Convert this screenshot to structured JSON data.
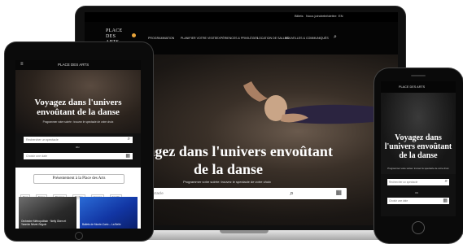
{
  "laptop": {
    "top_links": [
      "Billets",
      "Nous joindre",
      "Infolettre",
      "EN"
    ],
    "logo_lines": [
      "PLACE",
      "DES",
      "ARTS"
    ],
    "nav": [
      "PROGRAMMATION",
      "PLANIFIER VOTRE VISITE",
      "EXPÉRIENCES & PRIVILÈGES",
      "LOCATION DE SALLES",
      "NOUVELLES & COMMUNIQUÉS"
    ],
    "hero_title": "Voyagez dans l'univers envoûtant de la danse",
    "hero_subtitle": "Programmer votre soirée: trouvez le spectacle de votre choix",
    "search_placeholder": "Rechercher un spectacle",
    "search_icon": "magnifier",
    "calendar_icon": "calendar"
  },
  "tablet": {
    "logo": "PLACE DES ARTS",
    "hero_title": "Voyagez dans l'univers envoûtant de la danse",
    "hero_subtitle": "Programmer votre soirée : trouvez le spectacle de votre choix",
    "field1_placeholder": "Rechercher un spectacle",
    "or_label": "ou",
    "field2_placeholder": "Choisir une date",
    "section_heading": "Présentement à la Place des Arts",
    "tags": [
      "Tous",
      "Danse",
      "Musique",
      "Théâtre",
      "Humour",
      "Famille"
    ],
    "card1_text": "Orchestre Métropolitain · Nelly Oken et Yannick Nézet-Séguin",
    "card2_text": "Ballets de Monte-Carlo – La Belle"
  },
  "phone": {
    "logo": "PLACE DES ARTS",
    "hero_title": "Voyagez dans l'univers envoûtant de la danse",
    "hero_subtitle": "Programmer votre soirée: trouvez le spectacle de votre choix",
    "field1_placeholder": "Rechercher un spectacle",
    "or_label": "ou",
    "field2_placeholder": "Choisir une date"
  }
}
